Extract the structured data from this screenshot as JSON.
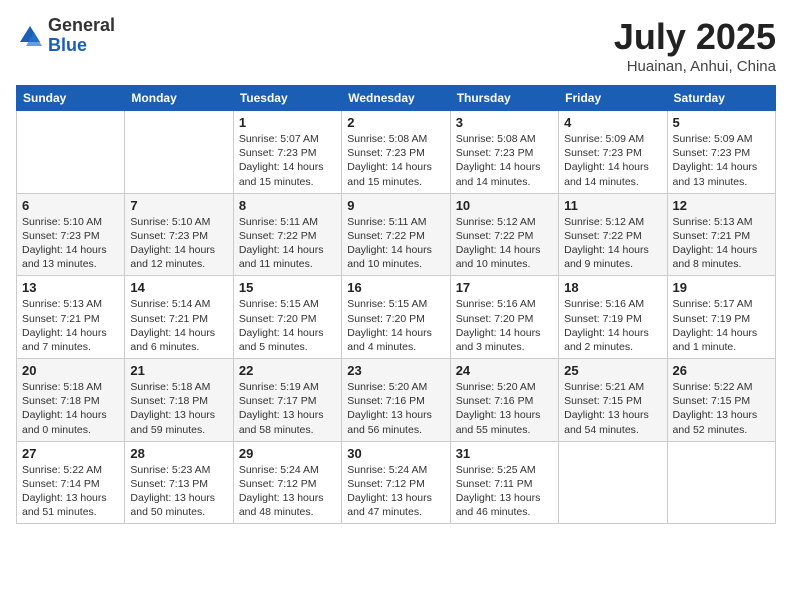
{
  "header": {
    "logo_general": "General",
    "logo_blue": "Blue",
    "month": "July 2025",
    "location": "Huainan, Anhui, China"
  },
  "days_of_week": [
    "Sunday",
    "Monday",
    "Tuesday",
    "Wednesday",
    "Thursday",
    "Friday",
    "Saturday"
  ],
  "weeks": [
    [
      {
        "num": "",
        "info": ""
      },
      {
        "num": "",
        "info": ""
      },
      {
        "num": "1",
        "info": "Sunrise: 5:07 AM\nSunset: 7:23 PM\nDaylight: 14 hours and 15 minutes."
      },
      {
        "num": "2",
        "info": "Sunrise: 5:08 AM\nSunset: 7:23 PM\nDaylight: 14 hours and 15 minutes."
      },
      {
        "num": "3",
        "info": "Sunrise: 5:08 AM\nSunset: 7:23 PM\nDaylight: 14 hours and 14 minutes."
      },
      {
        "num": "4",
        "info": "Sunrise: 5:09 AM\nSunset: 7:23 PM\nDaylight: 14 hours and 14 minutes."
      },
      {
        "num": "5",
        "info": "Sunrise: 5:09 AM\nSunset: 7:23 PM\nDaylight: 14 hours and 13 minutes."
      }
    ],
    [
      {
        "num": "6",
        "info": "Sunrise: 5:10 AM\nSunset: 7:23 PM\nDaylight: 14 hours and 13 minutes."
      },
      {
        "num": "7",
        "info": "Sunrise: 5:10 AM\nSunset: 7:23 PM\nDaylight: 14 hours and 12 minutes."
      },
      {
        "num": "8",
        "info": "Sunrise: 5:11 AM\nSunset: 7:22 PM\nDaylight: 14 hours and 11 minutes."
      },
      {
        "num": "9",
        "info": "Sunrise: 5:11 AM\nSunset: 7:22 PM\nDaylight: 14 hours and 10 minutes."
      },
      {
        "num": "10",
        "info": "Sunrise: 5:12 AM\nSunset: 7:22 PM\nDaylight: 14 hours and 10 minutes."
      },
      {
        "num": "11",
        "info": "Sunrise: 5:12 AM\nSunset: 7:22 PM\nDaylight: 14 hours and 9 minutes."
      },
      {
        "num": "12",
        "info": "Sunrise: 5:13 AM\nSunset: 7:21 PM\nDaylight: 14 hours and 8 minutes."
      }
    ],
    [
      {
        "num": "13",
        "info": "Sunrise: 5:13 AM\nSunset: 7:21 PM\nDaylight: 14 hours and 7 minutes."
      },
      {
        "num": "14",
        "info": "Sunrise: 5:14 AM\nSunset: 7:21 PM\nDaylight: 14 hours and 6 minutes."
      },
      {
        "num": "15",
        "info": "Sunrise: 5:15 AM\nSunset: 7:20 PM\nDaylight: 14 hours and 5 minutes."
      },
      {
        "num": "16",
        "info": "Sunrise: 5:15 AM\nSunset: 7:20 PM\nDaylight: 14 hours and 4 minutes."
      },
      {
        "num": "17",
        "info": "Sunrise: 5:16 AM\nSunset: 7:20 PM\nDaylight: 14 hours and 3 minutes."
      },
      {
        "num": "18",
        "info": "Sunrise: 5:16 AM\nSunset: 7:19 PM\nDaylight: 14 hours and 2 minutes."
      },
      {
        "num": "19",
        "info": "Sunrise: 5:17 AM\nSunset: 7:19 PM\nDaylight: 14 hours and 1 minute."
      }
    ],
    [
      {
        "num": "20",
        "info": "Sunrise: 5:18 AM\nSunset: 7:18 PM\nDaylight: 14 hours and 0 minutes."
      },
      {
        "num": "21",
        "info": "Sunrise: 5:18 AM\nSunset: 7:18 PM\nDaylight: 13 hours and 59 minutes."
      },
      {
        "num": "22",
        "info": "Sunrise: 5:19 AM\nSunset: 7:17 PM\nDaylight: 13 hours and 58 minutes."
      },
      {
        "num": "23",
        "info": "Sunrise: 5:20 AM\nSunset: 7:16 PM\nDaylight: 13 hours and 56 minutes."
      },
      {
        "num": "24",
        "info": "Sunrise: 5:20 AM\nSunset: 7:16 PM\nDaylight: 13 hours and 55 minutes."
      },
      {
        "num": "25",
        "info": "Sunrise: 5:21 AM\nSunset: 7:15 PM\nDaylight: 13 hours and 54 minutes."
      },
      {
        "num": "26",
        "info": "Sunrise: 5:22 AM\nSunset: 7:15 PM\nDaylight: 13 hours and 52 minutes."
      }
    ],
    [
      {
        "num": "27",
        "info": "Sunrise: 5:22 AM\nSunset: 7:14 PM\nDaylight: 13 hours and 51 minutes."
      },
      {
        "num": "28",
        "info": "Sunrise: 5:23 AM\nSunset: 7:13 PM\nDaylight: 13 hours and 50 minutes."
      },
      {
        "num": "29",
        "info": "Sunrise: 5:24 AM\nSunset: 7:12 PM\nDaylight: 13 hours and 48 minutes."
      },
      {
        "num": "30",
        "info": "Sunrise: 5:24 AM\nSunset: 7:12 PM\nDaylight: 13 hours and 47 minutes."
      },
      {
        "num": "31",
        "info": "Sunrise: 5:25 AM\nSunset: 7:11 PM\nDaylight: 13 hours and 46 minutes."
      },
      {
        "num": "",
        "info": ""
      },
      {
        "num": "",
        "info": ""
      }
    ]
  ]
}
